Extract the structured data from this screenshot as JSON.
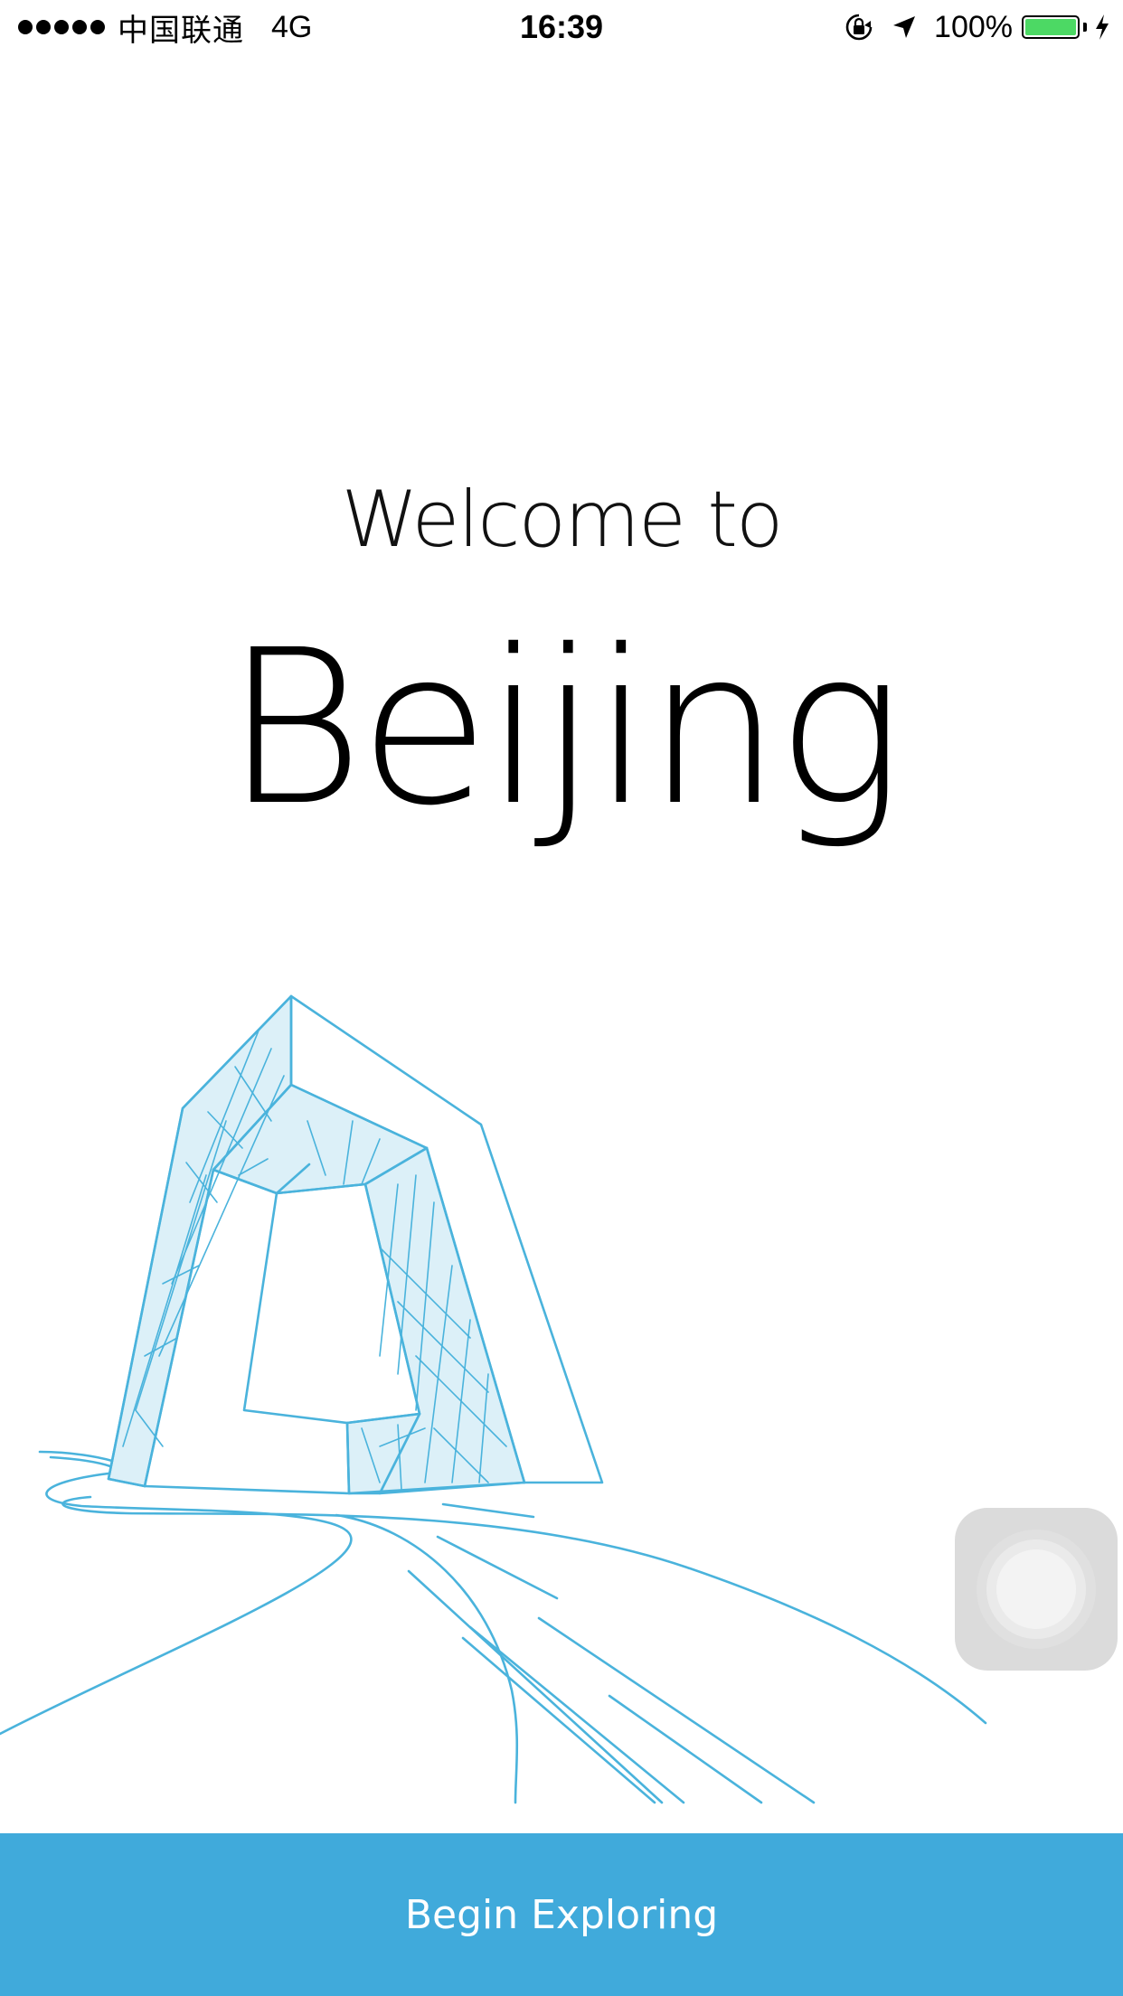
{
  "status_bar": {
    "carrier": "中国联通",
    "network": "4G",
    "time": "16:39",
    "battery_percent": "100%",
    "battery_color": "#4cd964"
  },
  "welcome": {
    "line1": "Welcome to",
    "city": "Beijing"
  },
  "illustration": {
    "subject": "cctv-tower-line-drawing",
    "stroke_color": "#4ab3dc",
    "fill_color": "#dcf0f8"
  },
  "cta": {
    "label": "Begin Exploring",
    "background": "#40aadb"
  }
}
